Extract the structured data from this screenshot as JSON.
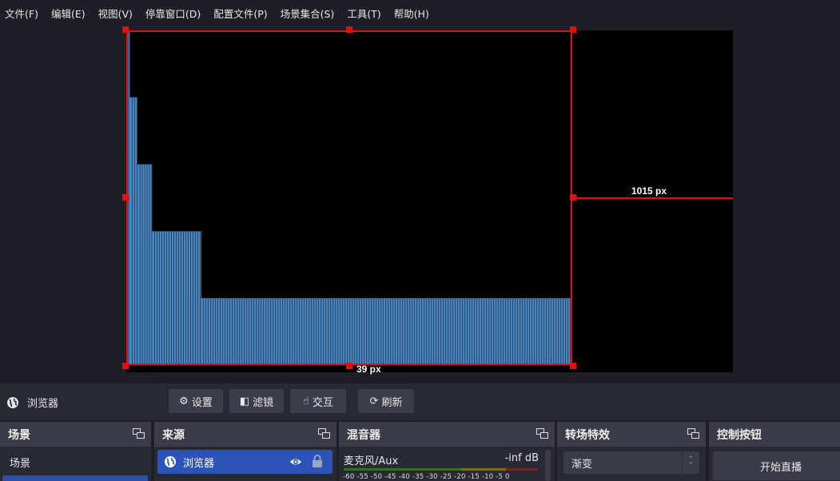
{
  "menu": [
    "文件(F)",
    "编辑(E)",
    "视图(V)",
    "停靠窗口(D)",
    "配置文件(P)",
    "场景集合(S)",
    "工具(T)",
    "帮助(H)"
  ],
  "preview": {
    "guide_right_label": "1015 px",
    "guide_bottom_label": "39 px",
    "selection_color": "#e01010",
    "bar_color": "#4a86c0",
    "bar_levels": [
      {
        "from": 0.0,
        "to": 0.008,
        "level": 1.0
      },
      {
        "from": 0.008,
        "to": 0.025,
        "level": 0.8
      },
      {
        "from": 0.025,
        "to": 0.058,
        "level": 0.6
      },
      {
        "from": 0.058,
        "to": 0.168,
        "level": 0.4
      },
      {
        "from": 0.168,
        "to": 1.0,
        "level": 0.2
      }
    ]
  },
  "source_toolbar": {
    "source_name": "浏览器",
    "settings_label": "设置",
    "filters_label": "滤镜",
    "interact_label": "交互",
    "refresh_label": "刷新"
  },
  "docks": {
    "scenes": {
      "title": "场景",
      "items": [
        "场景"
      ]
    },
    "sources": {
      "title": "来源",
      "items": [
        {
          "name": "浏览器"
        }
      ]
    },
    "mixer": {
      "title": "混音器",
      "channels": [
        {
          "name": "麦克风/Aux",
          "level": "-inf dB"
        }
      ],
      "scale": "-60 -55 -50 -45 -40 -35 -30 -25 -20 -15 -10 -5 0"
    },
    "transitions": {
      "title": "转场特效",
      "selected": "渐变"
    },
    "controls": {
      "title": "控制按钮",
      "start_stream": "开始直播"
    }
  }
}
